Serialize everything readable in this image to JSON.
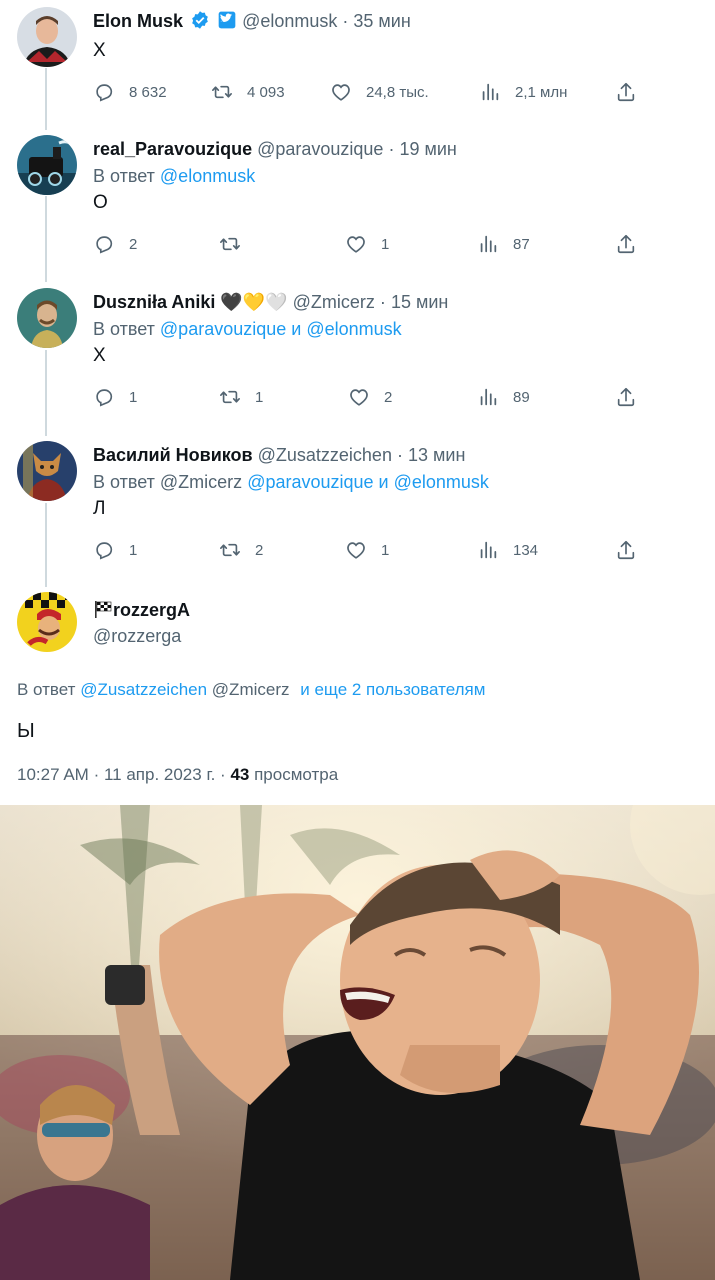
{
  "tweets": [
    {
      "name": "Elon Musk",
      "handle": "@elonmusk",
      "sep": "·",
      "time": "35 мин",
      "reply_prefix": "",
      "text": "Х",
      "replies": "8 632",
      "retweets": "4 093",
      "likes": "24,8 тыс.",
      "views": "2,1 млн"
    },
    {
      "name": "real_Paravouzique",
      "handle": "@paravouzique",
      "sep": "·",
      "time": "19 мин",
      "reply_prefix": "В ответ",
      "reply_mentions": "@elonmusk",
      "text": "О",
      "replies": "2",
      "retweets": "",
      "likes": "1",
      "views": "87"
    },
    {
      "name": "Dusznila Aniki",
      "name_display": "Duszniła Aniki",
      "emoji": "🖤💛🤍",
      "handle": "@Zmicerz",
      "sep": "·",
      "time": "15 мин",
      "reply_prefix": "В ответ",
      "reply_mentions": "@paravouzique и @elonmusk",
      "text": "Х",
      "replies": "1",
      "retweets": "1",
      "likes": "2",
      "views": "89"
    },
    {
      "name": "Василий Новиков",
      "handle": "@Zusatzzeichen",
      "sep": "·",
      "time": "13 мин",
      "reply_prefix": "В ответ",
      "reply_plain": "@Zmicerz",
      "reply_mentions": "@paravouzique и @elonmusk",
      "text": "Л",
      "replies": "1",
      "retweets": "2",
      "likes": "1",
      "views": "134"
    }
  ],
  "main_tweet": {
    "name": "rozzergA",
    "handle": "@rozzerga",
    "reply_prefix": "В ответ",
    "reply_mention_1": "@Zusatzzeichen",
    "reply_plain": "@Zmicerz",
    "reply_more": "и еще 2 пользователям",
    "text": "Ы",
    "time": "10:27 AM",
    "sep": "·",
    "date": "11 апр. 2023 г.",
    "views_count": "43",
    "views_label": "просмотра"
  },
  "colors": {
    "accent": "#1d9bf0",
    "text": "#0f1419",
    "secondary": "#536471",
    "thread_line": "#cfd9de"
  },
  "icons": [
    "verified-badge-icon",
    "twitter-blue-badge-icon",
    "reply-icon",
    "retweet-icon",
    "like-icon",
    "views-icon",
    "share-icon",
    "checkered-flag-icon"
  ]
}
